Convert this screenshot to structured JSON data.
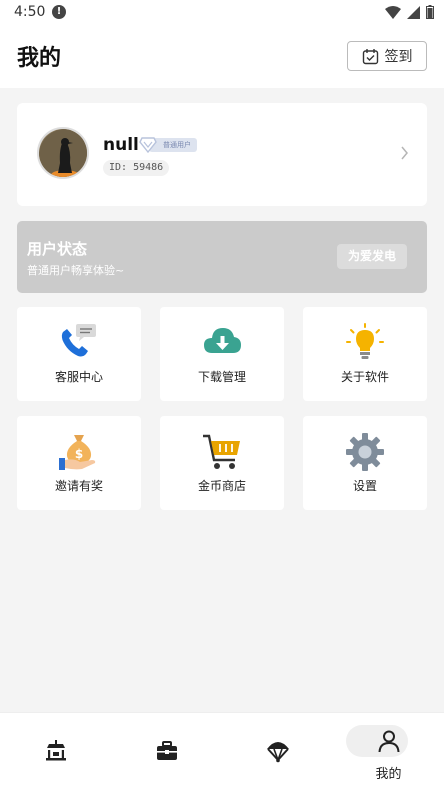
{
  "status_bar": {
    "time": "4:50"
  },
  "header": {
    "title": "我的",
    "checkin_label": "签到"
  },
  "profile": {
    "username": "null",
    "badge": "普通用户",
    "user_id": "ID: 59486"
  },
  "user_status": {
    "title": "用户状态",
    "subtitle": "普通用户畅享体验~",
    "button_label": "为爱发电"
  },
  "grid": [
    {
      "label": "客服中心",
      "icon": "customer-service-icon"
    },
    {
      "label": "下载管理",
      "icon": "cloud-download-icon"
    },
    {
      "label": "关于软件",
      "icon": "lightbulb-icon"
    },
    {
      "label": "邀请有奖",
      "icon": "money-bag-icon"
    },
    {
      "label": "金币商店",
      "icon": "shopping-cart-icon"
    },
    {
      "label": "设置",
      "icon": "gear-icon"
    }
  ],
  "bottom_nav": {
    "active_label": "我的"
  },
  "colors": {
    "accent_blue": "#1e6fd9",
    "cloud_green": "#3aa391",
    "bulb_yellow": "#f5b300",
    "cart_gold": "#e8a400",
    "status_card": "#cbcbcb"
  }
}
